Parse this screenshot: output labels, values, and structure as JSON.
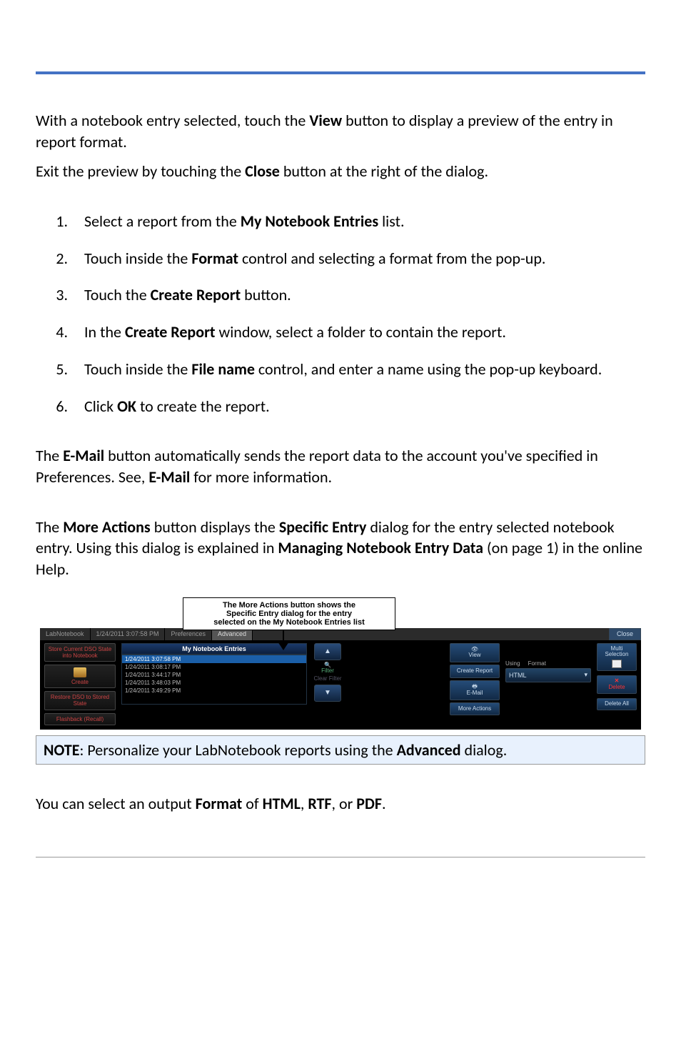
{
  "intro1_a": "With a notebook entry selected, touch the ",
  "intro1_b": " button to display a preview of the entry in report format.",
  "bold_view": "View",
  "intro2_a": "Exit the preview by touching the ",
  "intro2_b": " button at the right of the dialog.",
  "bold_close": "Close",
  "steps": [
    {
      "pre": "Select a report from the ",
      "bold": "My Notebook Entries",
      "post": " list."
    },
    {
      "pre": "Touch inside the ",
      "bold": "Format",
      "post": " control and selecting a format from the pop-up."
    },
    {
      "pre": "Touch the ",
      "bold": "Create Report",
      "post": " button."
    },
    {
      "pre": "In the ",
      "bold": "Create Report",
      "post": " window, select a folder to contain the report."
    },
    {
      "pre": "Touch inside the ",
      "bold": "File name",
      "post": " control, and enter a name using the pop-up keyboard."
    },
    {
      "pre": "Click ",
      "bold": "OK",
      "post": " to create the report."
    }
  ],
  "email_a": "The ",
  "email_bold1": "E-Mail",
  "email_b": " button automatically sends the report data to the account you've specified in Preferences. See, ",
  "email_bold2": "E-Mail",
  "email_c": " for more information.",
  "more_a": "The ",
  "more_bold1": "More Actions",
  "more_b": " button displays the ",
  "more_bold2": "Specific Entry",
  "more_c": " dialog for the entry selected notebook entry. Using this dialog is explained in ",
  "more_bold3": "Managing Notebook Entry Data",
  "more_d": " (on page 1) in the online Help.",
  "callout_l1": "The More Actions button shows the",
  "callout_l2": "Specific Entry dialog for the entry",
  "callout_l3": "selected on the My Notebook Entries list",
  "tabs": {
    "labnotebook": "LabNotebook",
    "datetime": "1/24/2011 3:07:58 PM",
    "prefs": "Preferences",
    "adv": "Advanced"
  },
  "close_label": "Close",
  "left": {
    "store": "Store Current DSO State into Notebook",
    "create": "Create",
    "restore": "Restore DSO to Stored State",
    "flashback": "Flashback (Recall)"
  },
  "mne_header": "My Notebook Entries",
  "entries": [
    "1/24/2011 3:07:58 PM",
    "1/24/2011 3:08:17 PM",
    "1/24/2011 3:44:17 PM",
    "1/24/2011 3:48:03 PM",
    "1/24/2011 3:49:29 PM"
  ],
  "scroll": {
    "filter": "Filter",
    "clear": "Clear Filter"
  },
  "actions": {
    "view": "View",
    "create_report": "Create Report",
    "email": "E-Mail",
    "more": "More Actions"
  },
  "using_label": "Using",
  "format_label": "Format",
  "format_value": "HTML",
  "right": {
    "multi": "Multi Selection",
    "delete": "Delete",
    "delete_all": "Delete All"
  },
  "note_bold": "NOTE",
  "note_mid": ": Personalize your LabNotebook reports using the ",
  "note_bold2": "Advanced",
  "note_end": " dialog.",
  "out_a": "You can select an output ",
  "out_b": "Format",
  "out_c": " of ",
  "out_d": "HTML",
  "out_e": ", ",
  "out_f": "RTF",
  "out_g": ", or ",
  "out_h": "PDF",
  "out_i": "."
}
